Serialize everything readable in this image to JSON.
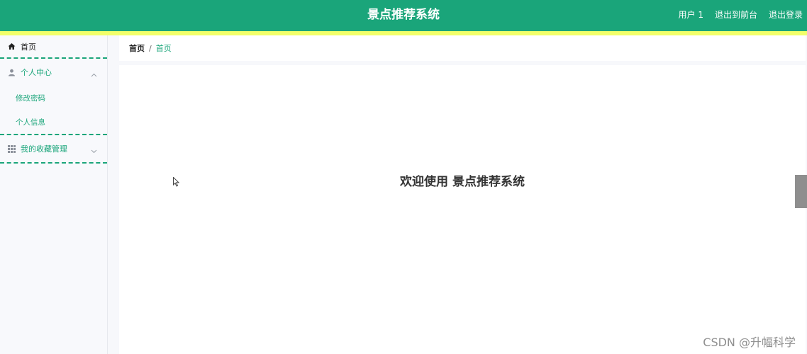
{
  "header": {
    "title": "景点推荐系统",
    "links": [
      "用户 1",
      "退出到前台",
      "退出登录"
    ]
  },
  "sidebar": {
    "home_label": "首页",
    "groups": [
      {
        "label": "个人中心",
        "expanded": true,
        "items": [
          "修改密码",
          "个人信息"
        ]
      },
      {
        "label": "我的收藏管理",
        "expanded": false,
        "items": []
      }
    ]
  },
  "breadcrumb": {
    "home": "首页",
    "separator": "/",
    "current": "首页"
  },
  "main": {
    "welcome": "欢迎使用 景点推荐系统"
  },
  "watermark": "CSDN @升幅科学",
  "colors": {
    "accent": "#1aa57a",
    "stripe": "#f2ff6a"
  }
}
